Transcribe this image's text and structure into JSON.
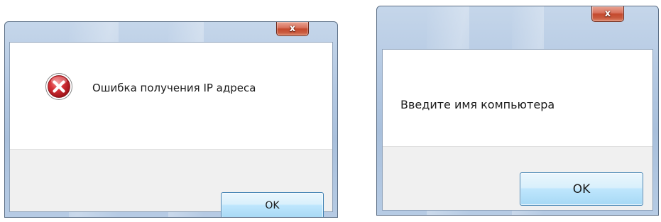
{
  "dialogs": [
    {
      "title": "",
      "close_glyph": "x",
      "icon": "error-icon",
      "message": "Ошибка получения IP адреса",
      "ok_label": "OK"
    },
    {
      "title": "",
      "close_glyph": "x",
      "icon": null,
      "message": "Введите имя компьютера",
      "ok_label": "OK"
    }
  ],
  "colors": {
    "titlebar": "#b3c8e2",
    "close_button": "#c44a2e",
    "button_area": "#f0f0f0",
    "ok_button_border": "#3c7fb1",
    "error_icon": "#c7282f"
  }
}
